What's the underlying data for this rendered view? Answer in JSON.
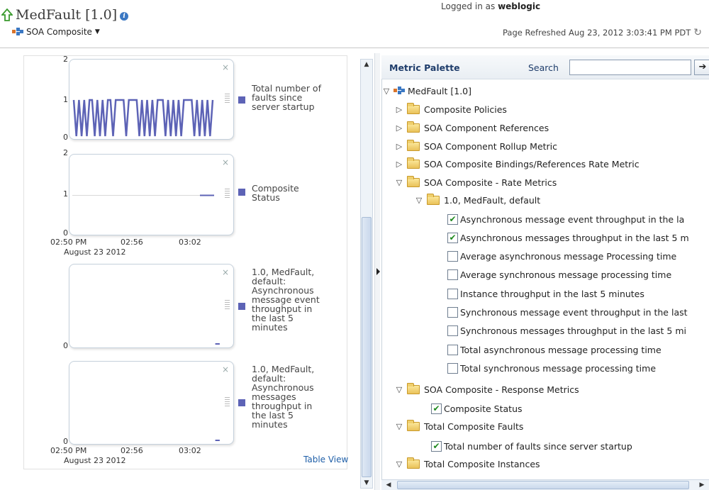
{
  "header": {
    "title": "MedFault [1.0]",
    "target_menu": "SOA Composite",
    "logged_in_prefix": "Logged in as",
    "logged_in_user": "weblogic",
    "refreshed": "Page Refreshed Aug 23, 2012 3:03:41 PM PDT"
  },
  "colors": {
    "series": "#5d63b6",
    "accent": "#1f3d6b",
    "check": "#1f8a1f"
  },
  "charts": {
    "table_view": "Table View",
    "x_axis": {
      "ticks": [
        "02:50 PM",
        "02:56",
        "03:02"
      ],
      "date": "August 23 2012"
    },
    "chart1": {
      "yticks": [
        "2",
        "1",
        "0"
      ],
      "legend": [
        "Total number of",
        "faults since",
        "server startup"
      ]
    },
    "chart2": {
      "yticks": [
        "2",
        "1",
        "0"
      ],
      "legend": [
        "Composite",
        "Status"
      ]
    },
    "chart3": {
      "yticks": [
        "0"
      ],
      "legend": [
        "1.0, MedFault,",
        "default:",
        "Asynchronous",
        "message event",
        "throughput in",
        "the last 5",
        "minutes"
      ]
    },
    "chart4": {
      "yticks": [
        "0"
      ],
      "legend": [
        "1.0, MedFault,",
        "default:",
        "Asynchronous",
        "messages",
        "throughput in",
        "the last 5",
        "minutes"
      ]
    }
  },
  "chart_data": [
    {
      "type": "line",
      "title": "",
      "series": [
        {
          "name": "Total number of faults since server startup",
          "values": [
            1,
            0,
            1,
            0,
            1,
            0,
            1,
            1,
            0,
            1,
            0,
            1,
            0,
            1,
            1,
            0,
            1,
            1,
            1,
            1,
            0,
            1,
            1,
            1,
            1,
            0,
            1,
            0,
            1,
            0,
            1,
            0,
            1,
            1,
            1,
            0,
            1,
            0,
            1,
            0,
            1,
            0,
            1,
            1,
            1,
            1,
            0,
            1,
            0,
            1,
            0,
            1,
            0,
            1
          ]
        }
      ],
      "ylim": [
        0,
        2
      ],
      "xticks": [
        "02:50 PM",
        "02:56",
        "03:02"
      ]
    },
    {
      "type": "line",
      "title": "",
      "series": [
        {
          "name": "Composite Status",
          "values": [
            1,
            1
          ]
        }
      ],
      "ylim": [
        0,
        2
      ],
      "xticks": [
        "02:50 PM",
        "02:56",
        "03:02"
      ]
    },
    {
      "type": "line",
      "title": "",
      "series": [
        {
          "name": "1.0, MedFault, default: Asynchronous message event throughput in the last 5 minutes",
          "values": [
            0
          ]
        }
      ],
      "ylim": [
        0,
        1
      ],
      "xticks": [
        "02:50 PM",
        "02:56",
        "03:02"
      ]
    },
    {
      "type": "line",
      "title": "",
      "series": [
        {
          "name": "1.0, MedFault, default: Asynchronous messages throughput in the last 5 minutes",
          "values": [
            0
          ]
        }
      ],
      "ylim": [
        0,
        1
      ],
      "xticks": [
        "02:50 PM",
        "02:56",
        "03:02"
      ]
    }
  ],
  "palette": {
    "title": "Metric Palette",
    "search_label": "Search",
    "search_value": "",
    "search_go": "➔",
    "root": "MedFault [1.0]",
    "nodes": {
      "policies": "Composite Policies",
      "comp_refs": "SOA Component References",
      "rollup": "SOA Component Rollup Metric",
      "bindings": "SOA Composite Bindings/References Rate Metric",
      "rate": "SOA Composite - Rate Metrics",
      "rate_child": "1.0, MedFault, default",
      "m1": "Asynchronous message event throughput in the la",
      "m2": "Asynchronous messages throughput in the last 5 m",
      "m3": "Average asynchronous message Processing time",
      "m4": "Average synchronous message processing time",
      "m5": "Instance throughput in the last 5 minutes",
      "m6": "Synchronous message event throughput in the last",
      "m7": "Synchronous messages throughput in the last 5 mi",
      "m8": "Total asynchronous message processing time",
      "m9": "Total synchronous message processing time",
      "response": "SOA Composite - Response Metrics",
      "m10": "Composite Status",
      "faults": "Total Composite Faults",
      "m11": "Total number of faults since server startup",
      "instances": "Total Composite Instances"
    },
    "checks": {
      "m1": true,
      "m2": true,
      "m3": false,
      "m4": false,
      "m5": false,
      "m6": false,
      "m7": false,
      "m8": false,
      "m9": false,
      "m10": true,
      "m11": true
    }
  }
}
